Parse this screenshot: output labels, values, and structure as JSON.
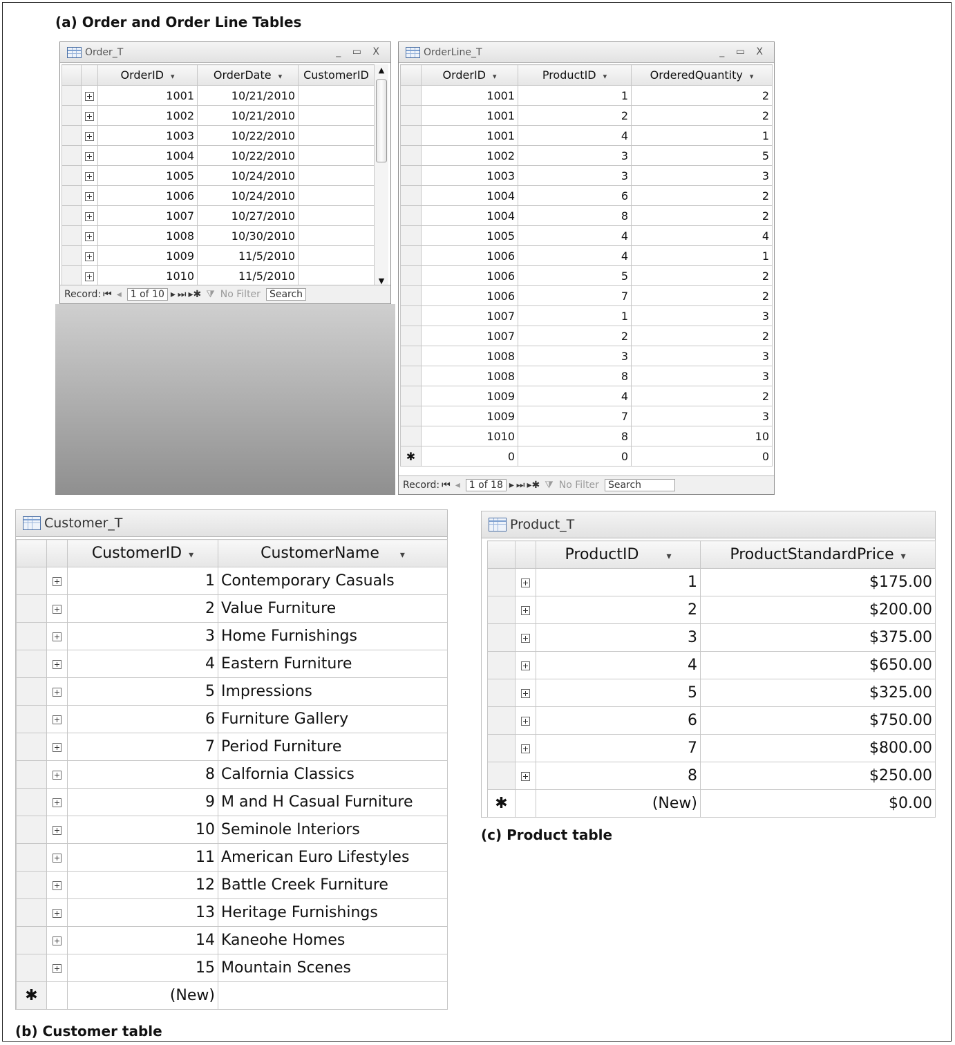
{
  "captions": {
    "a": "(a) Order and Order Line Tables",
    "b": "(b) Customer table",
    "c": "(c) Product table"
  },
  "order_t": {
    "title": "Order_T",
    "window_buttons": "_ ▭ X",
    "columns": [
      "OrderID",
      "OrderDate",
      "CustomerID"
    ],
    "rows": [
      [
        "1001",
        "10/21/2010",
        ""
      ],
      [
        "1002",
        "10/21/2010",
        ""
      ],
      [
        "1003",
        "10/22/2010",
        ""
      ],
      [
        "1004",
        "10/22/2010",
        ""
      ],
      [
        "1005",
        "10/24/2010",
        ""
      ],
      [
        "1006",
        "10/24/2010",
        ""
      ],
      [
        "1007",
        "10/27/2010",
        ""
      ],
      [
        "1008",
        "10/30/2010",
        ""
      ],
      [
        "1009",
        "11/5/2010",
        ""
      ],
      [
        "1010",
        "11/5/2010",
        ""
      ]
    ],
    "nav": {
      "record_label": "Record:",
      "position": "1 of 10",
      "filter": "No Filter",
      "search": "Search"
    }
  },
  "orderline_t": {
    "title": "OrderLine_T",
    "window_buttons": "_ ▭ X",
    "columns": [
      "OrderID",
      "ProductID",
      "OrderedQuantity"
    ],
    "rows": [
      [
        "1001",
        "1",
        "2"
      ],
      [
        "1001",
        "2",
        "2"
      ],
      [
        "1001",
        "4",
        "1"
      ],
      [
        "1002",
        "3",
        "5"
      ],
      [
        "1003",
        "3",
        "3"
      ],
      [
        "1004",
        "6",
        "2"
      ],
      [
        "1004",
        "8",
        "2"
      ],
      [
        "1005",
        "4",
        "4"
      ],
      [
        "1006",
        "4",
        "1"
      ],
      [
        "1006",
        "5",
        "2"
      ],
      [
        "1006",
        "7",
        "2"
      ],
      [
        "1007",
        "1",
        "3"
      ],
      [
        "1007",
        "2",
        "2"
      ],
      [
        "1008",
        "3",
        "3"
      ],
      [
        "1008",
        "8",
        "3"
      ],
      [
        "1009",
        "4",
        "2"
      ],
      [
        "1009",
        "7",
        "3"
      ],
      [
        "1010",
        "8",
        "10"
      ]
    ],
    "new_row": [
      "0",
      "0",
      "0"
    ],
    "new_marker": "✱",
    "nav": {
      "record_label": "Record:",
      "position": "1 of 18",
      "filter": "No Filter",
      "search": "Search"
    }
  },
  "customer_t": {
    "title": "Customer_T",
    "columns": [
      "CustomerID",
      "CustomerName"
    ],
    "rows": [
      [
        "1",
        "Contemporary Casuals"
      ],
      [
        "2",
        "Value Furniture"
      ],
      [
        "3",
        "Home Furnishings"
      ],
      [
        "4",
        "Eastern Furniture"
      ],
      [
        "5",
        "Impressions"
      ],
      [
        "6",
        "Furniture Gallery"
      ],
      [
        "7",
        "Period Furniture"
      ],
      [
        "8",
        "Calfornia Classics"
      ],
      [
        "9",
        "M and H Casual Furniture"
      ],
      [
        "10",
        "Seminole Interiors"
      ],
      [
        "11",
        "American Euro Lifestyles"
      ],
      [
        "12",
        "Battle Creek Furniture"
      ],
      [
        "13",
        "Heritage Furnishings"
      ],
      [
        "14",
        "Kaneohe Homes"
      ],
      [
        "15",
        "Mountain Scenes"
      ]
    ],
    "new_row": [
      "(New)",
      ""
    ],
    "new_marker": "✱"
  },
  "product_t": {
    "title": "Product_T",
    "columns": [
      "ProductID",
      "ProductStandardPrice"
    ],
    "rows": [
      [
        "1",
        "$175.00"
      ],
      [
        "2",
        "$200.00"
      ],
      [
        "3",
        "$375.00"
      ],
      [
        "4",
        "$650.00"
      ],
      [
        "5",
        "$325.00"
      ],
      [
        "6",
        "$750.00"
      ],
      [
        "7",
        "$800.00"
      ],
      [
        "8",
        "$250.00"
      ]
    ],
    "new_row": [
      "(New)",
      "$0.00"
    ],
    "new_marker": "✱"
  },
  "icons": {
    "expand": "plus-box-icon",
    "dropdown": "chevron-down-icon",
    "new_record": "asterisk-icon"
  }
}
